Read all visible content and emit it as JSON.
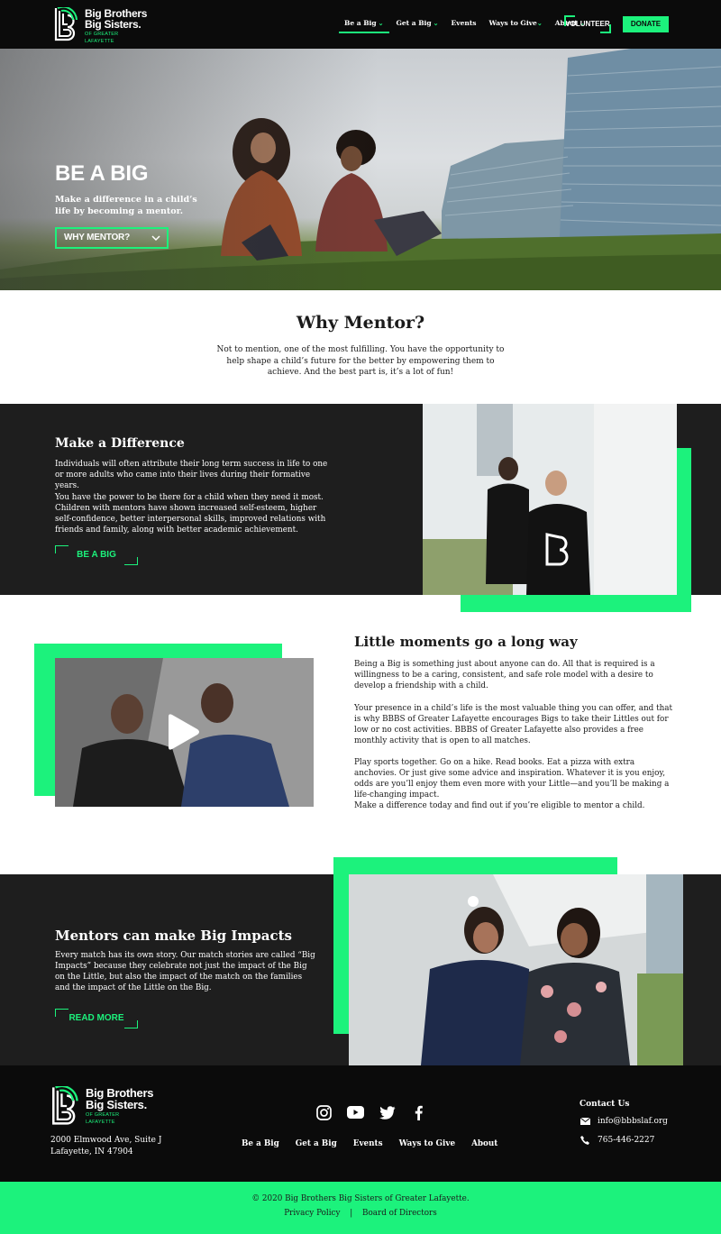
{
  "brand": {
    "name_line1": "Big Brothers",
    "name_line2": "Big Sisters.",
    "sub_line1": "OF GREATER",
    "sub_line2": "LAFAYETTE",
    "accent": "#1cf27c",
    "dark": "#1e1e1e",
    "black": "#0b0b0b"
  },
  "nav": {
    "items": [
      {
        "label": "Be a Big",
        "chevron": "⌄"
      },
      {
        "label": "Get a Big",
        "chevron": "⌄"
      },
      {
        "label": "Events",
        "chevron": ""
      },
      {
        "label": "Ways to Give",
        "chevron": "⌄"
      },
      {
        "label": "About",
        "chevron": "⌄"
      }
    ],
    "volunteer_label": "VOLUNTEER",
    "donate_label": "DONATE"
  },
  "hero": {
    "title": "BE A BIG",
    "subtitle": "Make a difference in a child’s life by becoming a mentor.",
    "button_label": "WHY MENTOR?",
    "button_icon": "chevron-down-icon"
  },
  "why": {
    "title": "Why Mentor?",
    "text": "Not to mention, one of the most fulfilling. You have the opportunity to help shape a child’s future for the better by empowering them to achieve. And the best part is, it’s a lot of fun!"
  },
  "difference": {
    "title": "Make a Difference",
    "para1": "Individuals will often attribute their long term success in life to one or more adults who came into their lives during their formative years.",
    "para2": "You have the power to be there for a child when they need it most. Children with mentors have shown increased self-esteem, higher self-confidence, better interpersonal skills, improved relations with friends and family, along with better academic achievement.",
    "button_label": "BE A BIG"
  },
  "moments": {
    "title": "Little moments go a long way",
    "para1": "Being a Big is something just about anyone can do. All that is required is a willingness to be a caring, consistent, and safe role model with a desire to develop a friendship with a child.",
    "para2": "Your presence in a child’s life is the most valuable thing you can offer, and that is why BBBS of Greater Lafayette encourages Bigs to take their Littles out for low or no cost activities. BBBS of Greater Lafayette also provides a free monthly activity that is open to all matches.",
    "para3": "Play sports together. Go on a hike. Read books. Eat a pizza with extra anchovies. Or just give some advice and inspiration. Whatever it is you enjoy, odds are you’ll enjoy them even more with your Little—and you’ll be making a life-changing impact.",
    "para4": "Make a difference today and find out if you’re eligible to mentor a child."
  },
  "impacts": {
    "title": "Mentors can make Big Impacts",
    "text": "Every match has its own story. Our match stories are called “Big Impacts” because they celebrate not just the impact of the Big on the Little, but also the impact of the match on the families and the impact of the Little on the Big.",
    "button_label": "READ MORE"
  },
  "footer": {
    "address_line1": "2000 Elmwood Ave, Suite J",
    "address_line2": "Lafayette, IN 47904",
    "socials": [
      "instagram-icon",
      "youtube-icon",
      "twitter-icon",
      "facebook-icon"
    ],
    "links": [
      "Be a Big",
      "Get a Big",
      "Events",
      "Ways to Give",
      "About"
    ],
    "contact_title": "Contact Us",
    "email": "info@bbbslaf.org",
    "phone": "765-446-2227",
    "copyright": "© 2020 Big Brothers Big Sisters of Greater Lafayette.",
    "bottom_links": [
      "Privacy Policy",
      "Board of Directors"
    ],
    "separator": "|"
  }
}
